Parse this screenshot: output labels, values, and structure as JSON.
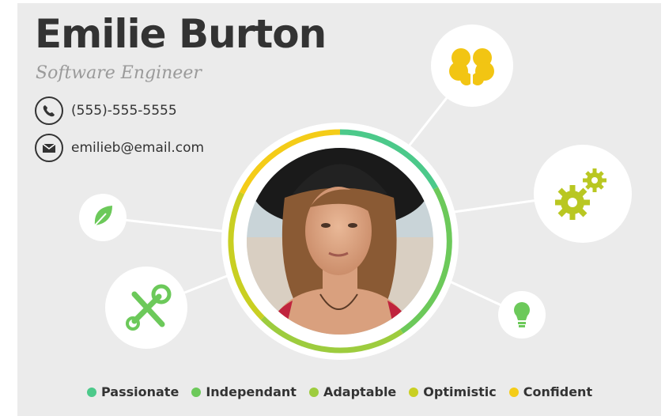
{
  "profile": {
    "name": "Emilie Burton",
    "title": "Software Engineer",
    "phone": "(555)-555-5555",
    "email": "emilieb@email.com"
  },
  "skills": [
    {
      "label": "Passionate",
      "color": "#4cc98a"
    },
    {
      "label": "Independant",
      "color": "#6cc95a"
    },
    {
      "label": "Adaptable",
      "color": "#9dcc3e"
    },
    {
      "label": "Optimistic",
      "color": "#c9cf22"
    },
    {
      "label": "Confident",
      "color": "#f4cc18"
    }
  ],
  "icons": [
    "brain-icon",
    "gears-icon",
    "lightbulb-icon",
    "tools-icon",
    "leaf-icon",
    "phone-icon",
    "mail-icon"
  ]
}
